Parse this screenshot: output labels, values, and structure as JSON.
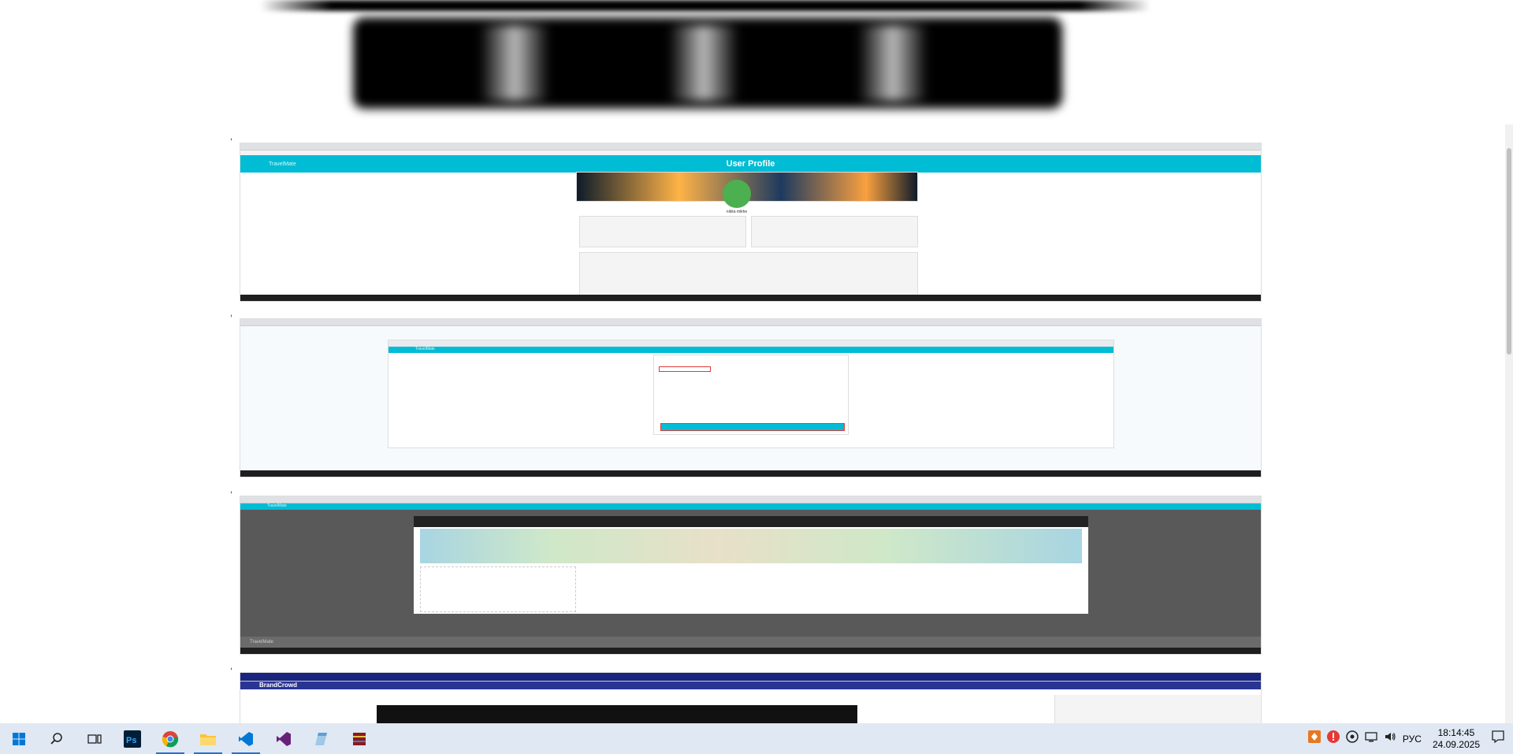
{
  "screenshots": [
    {
      "title": "User Profile",
      "brand": "TravelMate",
      "user": "nikita mikhe"
    },
    {
      "title": "",
      "brand": "TravelMate"
    },
    {
      "title": "",
      "brand": "TravelMate",
      "footer": "TravelMate"
    },
    {
      "title": "",
      "brand": "BrandCrowd"
    }
  ],
  "taskbar": {
    "apps": [
      "start-icon",
      "search-icon",
      "task-view-icon",
      "photoshop-icon",
      "chrome-icon",
      "explorer-icon",
      "vscode-icon",
      "visual-studio-icon",
      "notepad-icon",
      "winrar-icon"
    ],
    "time": "18:14:45",
    "date": "24.09.2025",
    "lang": "РУС"
  },
  "colors": {
    "accent": "#00bcd4",
    "taskbar": "#dfe8f3",
    "highlight": "#2c6fd1"
  }
}
